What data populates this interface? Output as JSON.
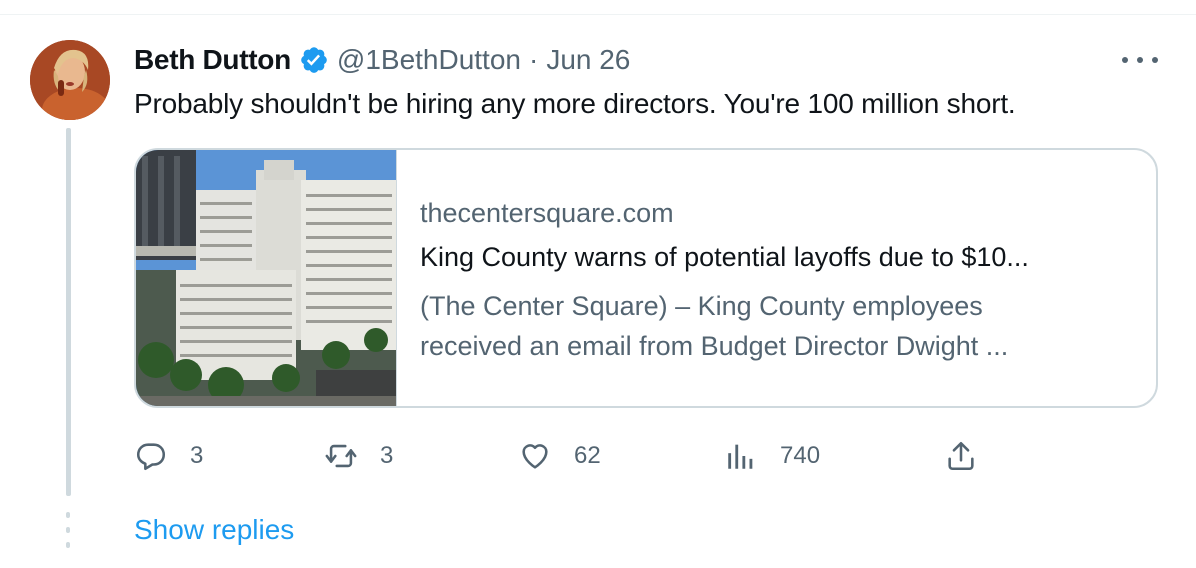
{
  "tweet": {
    "display_name": "Beth Dutton",
    "handle": "@1BethDutton",
    "separator": "·",
    "date": "Jun 26",
    "text": "Probably shouldn't be hiring any more directors. You're 100 million short.",
    "verified": true,
    "verified_color": "#1d9bf0"
  },
  "card": {
    "domain": "thecentersquare.com",
    "title": "King County warns of potential layoffs due to $10...",
    "description_line1": "(The Center Square) – King County employees",
    "description_line2": "received an email from Budget Director Dwight ..."
  },
  "actions": {
    "replies": "3",
    "retweets": "3",
    "likes": "62",
    "views": "740",
    "reply_icon": "reply-icon",
    "retweet_icon": "retweet-icon",
    "like_icon": "heart-icon",
    "views_icon": "views-bar-chart-icon",
    "share_icon": "share-upload-icon"
  },
  "show_replies": "Show replies",
  "colors": {
    "link": "#1d9bf0",
    "secondary_text": "#536471",
    "primary_text": "#0f1419",
    "border": "#cfd9de"
  }
}
